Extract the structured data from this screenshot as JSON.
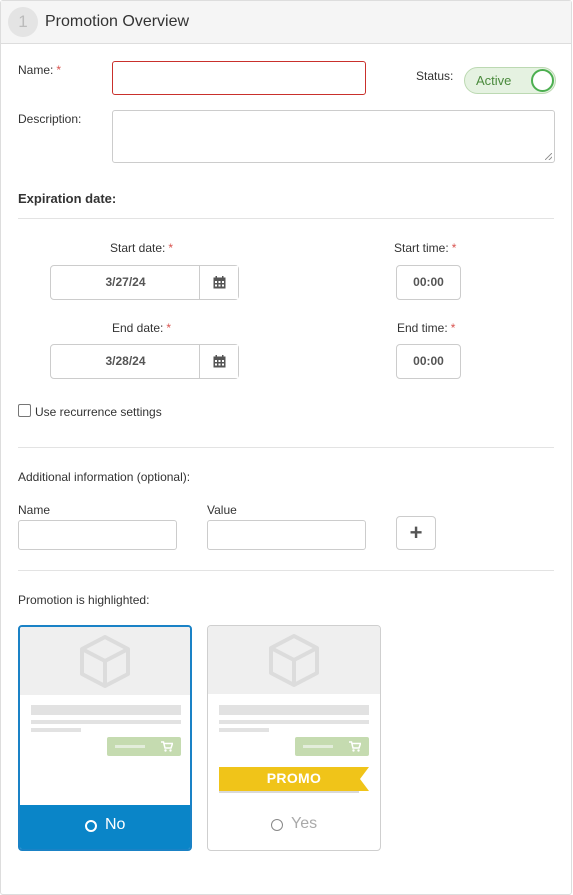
{
  "panel": {
    "step_number": "1",
    "title": "Promotion Overview"
  },
  "name_field": {
    "label": "Name:",
    "required_mark": "*",
    "value": ""
  },
  "status": {
    "label": "Status:",
    "toggle_text": "Active",
    "checked": true
  },
  "description_field": {
    "label": "Description:",
    "value": ""
  },
  "expiration": {
    "title": "Expiration date:",
    "start_date_label": "Start date:",
    "start_date_value": "3/27/24",
    "start_time_label": "Start time:",
    "start_time_value": "00:00",
    "end_date_label": "End date:",
    "end_date_value": "3/28/24",
    "end_time_label": "End time:",
    "end_time_value": "00:00",
    "required_mark": "*"
  },
  "recurrence": {
    "label": "Use recurrence settings",
    "checked": false
  },
  "additional": {
    "title": "Additional information (optional):",
    "name_label": "Name",
    "value_label": "Value",
    "name_value": "",
    "value_value": "",
    "add_button": "+"
  },
  "highlight": {
    "label": "Promotion is highlighted:",
    "options": [
      {
        "label": "No",
        "selected": true
      },
      {
        "label": "Yes",
        "selected": false,
        "badge": "PROMO"
      }
    ]
  },
  "colors": {
    "accent": "#0a85c8",
    "required": "#d9534f",
    "toggle_on": "#4caf50",
    "promo": "#f0c419"
  },
  "icons": [
    "calendar-icon",
    "plus-icon",
    "box-icon",
    "cart-icon",
    "radio-icon"
  ]
}
